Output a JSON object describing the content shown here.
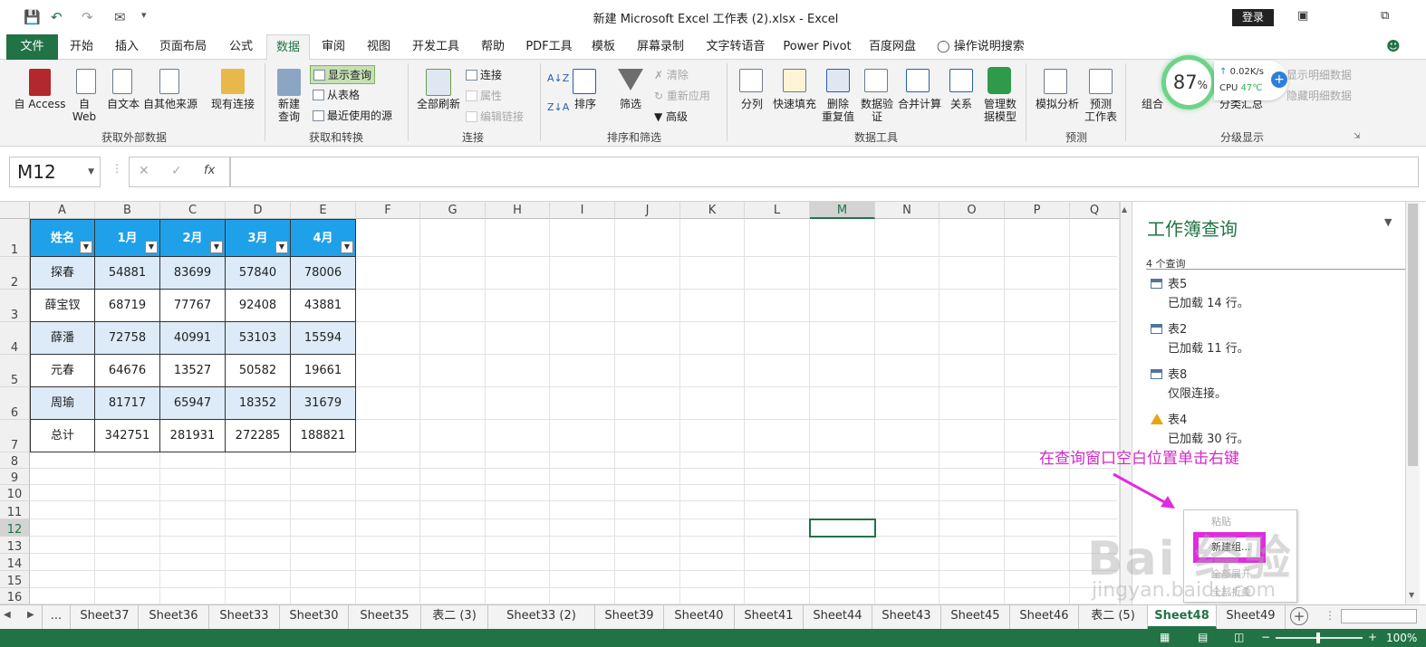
{
  "window": {
    "title": "新建 Microsoft Excel 工作表 (2).xlsx  -  Excel",
    "login": "登录"
  },
  "menu": {
    "tabs": [
      "文件",
      "开始",
      "插入",
      "页面布局",
      "公式",
      "数据",
      "审阅",
      "视图",
      "开发工具",
      "帮助",
      "PDF工具",
      "模板",
      "屏幕录制",
      "文字转语音",
      "Power Pivot",
      "百度网盘"
    ],
    "search": "操作说明搜索",
    "active": "数据"
  },
  "ribbon": {
    "get_external": {
      "label": "获取外部数据",
      "buttons": [
        "自 Access",
        "自\nWeb",
        "自文本",
        "自其他来源",
        "现有连接"
      ]
    },
    "get_transform": {
      "label": "获取和转换",
      "new_query": "新建\n查询",
      "show_queries": "显示查询",
      "from_table": "从表格",
      "recent_sources": "最近使用的源"
    },
    "connections": {
      "label": "连接",
      "refresh_all": "全部刷新",
      "connections": "连接",
      "properties": "属性",
      "edit_links": "编辑链接"
    },
    "sort_filter": {
      "label": "排序和筛选",
      "sort": "排序",
      "filter": "筛选",
      "clear": "清除",
      "reapply": "重新应用",
      "advanced": "高级"
    },
    "data_tools": {
      "label": "数据工具",
      "buttons": [
        "分列",
        "快速填充",
        "删除\n重复值",
        "数据验\n证",
        "合并计算",
        "关系",
        "管理数\n据模型"
      ]
    },
    "forecast": {
      "label": "预测",
      "buttons": [
        "模拟分析",
        "预测\n工作表"
      ]
    },
    "outline": {
      "label": "分级显示",
      "group": "组合",
      "subtotal": "分类汇总",
      "show_detail": "显示明细数据",
      "hide_detail": "隐藏明细数据"
    }
  },
  "formula_bar": {
    "name_box": "M12",
    "fx": "fx",
    "value": ""
  },
  "sheet": {
    "columns": [
      "A",
      "B",
      "C",
      "D",
      "E",
      "F",
      "G",
      "H",
      "I",
      "J",
      "K",
      "L",
      "M",
      "N",
      "O",
      "P",
      "Q"
    ],
    "rows": [
      "1",
      "2",
      "3",
      "4",
      "5",
      "6",
      "7",
      "8",
      "9",
      "10",
      "11",
      "12",
      "13",
      "14",
      "15",
      "16"
    ],
    "selected_cell": "M12",
    "table_headers": [
      "姓名",
      "1月",
      "2月",
      "3月",
      "4月"
    ],
    "table_rows": [
      [
        "探春",
        "54881",
        "83699",
        "57840",
        "78006"
      ],
      [
        "薛宝钗",
        "68719",
        "77767",
        "92408",
        "43881"
      ],
      [
        "薛潘",
        "72758",
        "40991",
        "53103",
        "15594"
      ],
      [
        "元春",
        "64676",
        "13527",
        "50582",
        "19661"
      ],
      [
        "周瑜",
        "81717",
        "65947",
        "18352",
        "31679"
      ],
      [
        "总计",
        "342751",
        "281931",
        "272285",
        "188821"
      ]
    ]
  },
  "query_pane": {
    "title": "工作簿查询",
    "count": "4 个查询",
    "queries": [
      {
        "name": "表5",
        "status": "已加载 14 行。",
        "icon": "table-icon"
      },
      {
        "name": "表2",
        "status": "已加载 11 行。",
        "icon": "table-icon"
      },
      {
        "name": "表8",
        "status": "仅限连接。",
        "icon": "table-icon"
      },
      {
        "name": "表4",
        "status": "已加载 30 行。",
        "icon": "warning-icon"
      }
    ]
  },
  "context_menu": {
    "items": [
      "粘贴",
      "新建组...",
      "全部展开",
      "全部折叠"
    ]
  },
  "annotation": "在查询窗口空白位置单击右键",
  "sheet_tabs": {
    "more": "...",
    "tabs": [
      "Sheet37",
      "Sheet36",
      "Sheet33",
      "Sheet30",
      "Sheet35",
      "表二 (3)",
      "Sheet33 (2)",
      "Sheet39",
      "Sheet40",
      "Sheet41",
      "Sheet44",
      "Sheet43",
      "Sheet45",
      "Sheet46",
      "表二 (5)",
      "Sheet48",
      "Sheet49"
    ],
    "active": "Sheet48"
  },
  "status": {
    "zoom": "100%"
  },
  "perf_widget": {
    "percent": "87",
    "unit": "%",
    "net": "0.02K/s",
    "cpu_label": "CPU",
    "cpu": "47℃"
  },
  "watermark": {
    "text": "Bai 经验",
    "url": "jingyan.baidu.com"
  },
  "colors": {
    "excel_green": "#217346",
    "header_blue": "#1fa1ea",
    "band_blue": "#dcebf7",
    "annotation_magenta": "#d329c9"
  }
}
